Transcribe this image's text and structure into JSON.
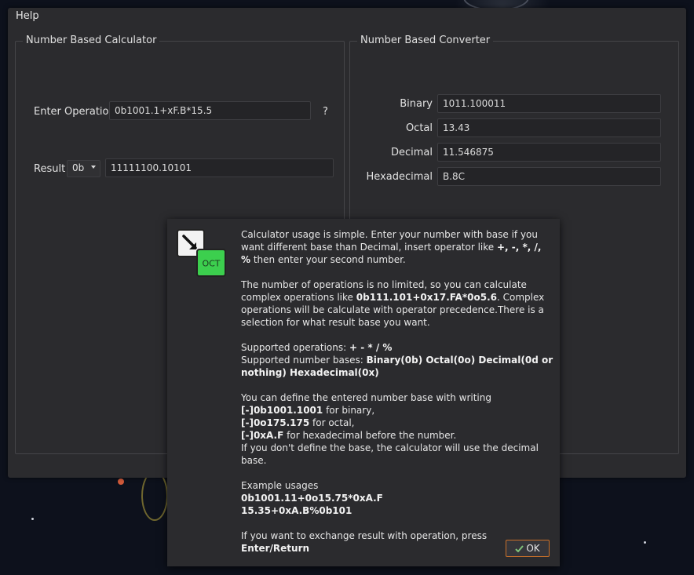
{
  "menu": {
    "help": "Help"
  },
  "calculator": {
    "title": "Number Based Calculator",
    "enter_operation_label": "Enter Operation",
    "operation_value": "0b1001.1+xF.B*15.5",
    "help_button": "?",
    "result_label": "Result",
    "result_base": "0b",
    "result_value": "11111100.10101"
  },
  "converter": {
    "title": "Number Based Converter",
    "rows": [
      {
        "label": "Binary",
        "value": "1011.100011"
      },
      {
        "label": "Octal",
        "value": "13.43"
      },
      {
        "label": "Decimal",
        "value": "11.546875"
      },
      {
        "label": "Hexadecimal",
        "value": "B.8C"
      }
    ]
  },
  "dialog": {
    "icon_text": "OCT",
    "p1_a": "Calculator usage is simple. Enter your number with base if you want different base than Decimal, insert operator like ",
    "p1_b": "+, -, *, /, %",
    "p1_c": " then enter your second number.",
    "p2_a": "The number of operations is no limited, so you can calculate complex operations like ",
    "p2_b": "0b111.101+0x17.FA*0o5.6",
    "p2_c": ". Complex operations will be calculate with operator precedence.There is a selection for what result base you want.",
    "ops_label": "Supported operations: ",
    "ops_value": "+ - * / %",
    "bases_label": "Supported number bases: ",
    "bases_value": "Binary(0b) Octal(0o) Decimal(0d or nothing) Hexadecimal(0x)",
    "def_intro": "You can define the entered number base with writing",
    "def_bin_code": "[-]0b1001.1001",
    "def_bin_text": " for binary,",
    "def_oct_code": "[-]0o175.175",
    "def_oct_text": " for octal,",
    "def_hex_code": "[-]0xA.F",
    "def_hex_text": " for hexadecimal before the number.",
    "def_note": "If you don't define the base, the calculator will use the decimal base.",
    "examples_label": "Example usages",
    "example1": "0b1001.11+0o15.75*0xA.F",
    "example2": "15.35+0xA.B%0b101",
    "exchange_a": "If you want to exchange result with operation, press ",
    "exchange_b": "Enter/Return",
    "ok_label": "OK"
  },
  "colors": {
    "accent": "#c8702a",
    "icon_green": "#3ccf4e",
    "background": "#2b2b2e"
  }
}
